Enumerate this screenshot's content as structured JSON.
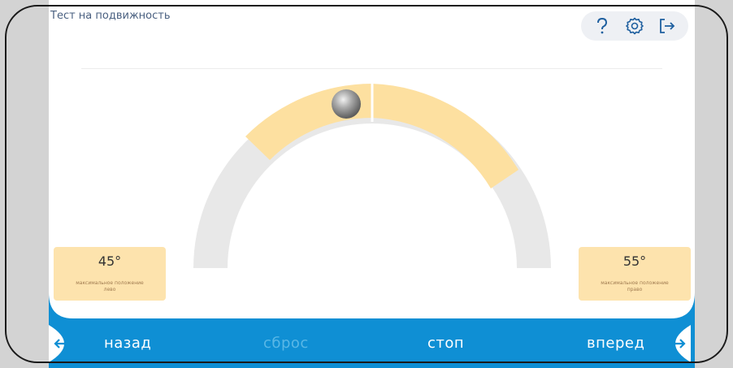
{
  "app": {
    "title": "Тест на подвижность"
  },
  "toolbar": {
    "help_icon": "question-mark",
    "settings_icon": "gear",
    "exit_icon": "exit-arrow"
  },
  "gauge": {
    "left_max": {
      "value": "45°",
      "caption_line1": "максимальное положение",
      "caption_line2": "лево"
    },
    "right_max": {
      "value": "55°",
      "caption_line1": "максимальное положение",
      "caption_line2": "право"
    },
    "colors": {
      "track": "#e8e8e8",
      "range": "#fde0a0",
      "indicator": "#9a9a9a"
    }
  },
  "nav": {
    "back_label": "назад",
    "reset_label": "сброс",
    "stop_label": "стоп",
    "forward_label": "вперед",
    "color": "#0f8fd4"
  }
}
